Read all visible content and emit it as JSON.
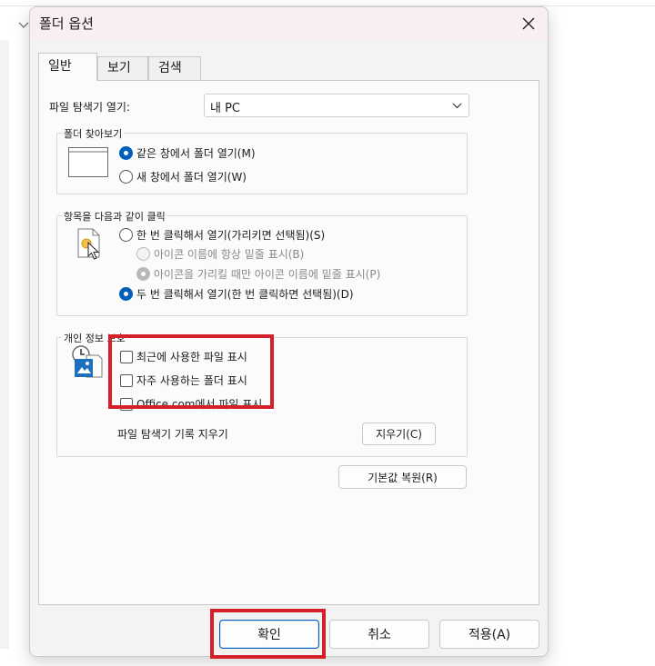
{
  "dialog": {
    "title": "폴더 옵션",
    "close_icon": "close-icon",
    "tabs": [
      {
        "label": "일반",
        "active": true
      },
      {
        "label": "보기",
        "active": false
      },
      {
        "label": "검색",
        "active": false
      }
    ],
    "open_explorer": {
      "label": "파일 탐색기 열기:",
      "value": "내 PC"
    },
    "browse_folders": {
      "legend": "폴더 찾아보기",
      "options": [
        {
          "label": "같은 창에서 폴더 열기(M)",
          "checked": true
        },
        {
          "label": "새 창에서 폴더 열기(W)",
          "checked": false
        }
      ]
    },
    "click_items": {
      "legend": "항목을 다음과 같이 클릭",
      "single_click": {
        "label": "한 번 클릭해서 열기(가리키면 선택됨)(S)",
        "checked": false
      },
      "underline_always": {
        "label": "아이콘 이름에 항상 밑줄 표시(B)",
        "checked": false,
        "disabled": true
      },
      "underline_hover": {
        "label": "아이콘을 가리킬 때만 아이콘 이름에 밑줄 표시(P)",
        "checked": true,
        "disabled": true
      },
      "double_click": {
        "label": "두 번 클릭해서 열기(한 번 클릭하면 선택됨)(D)",
        "checked": true
      }
    },
    "privacy": {
      "legend": "개인 정보 보호",
      "options": [
        {
          "label": "최근에 사용한 파일 표시",
          "checked": false
        },
        {
          "label": "자주 사용하는 폴더 표시",
          "checked": false
        },
        {
          "label": "Office.com에서 파일 표시",
          "checked": false
        }
      ],
      "clear_label": "파일 탐색기 기록 지우기",
      "clear_button": "지우기(C)"
    },
    "restore_defaults": "기본값 복원(R)",
    "buttons": {
      "ok": "확인",
      "cancel": "취소",
      "apply": "적용(A)"
    }
  },
  "colors": {
    "accent": "#005fb8",
    "highlight": "#d4202a",
    "titlebar": "#f9eef0"
  }
}
